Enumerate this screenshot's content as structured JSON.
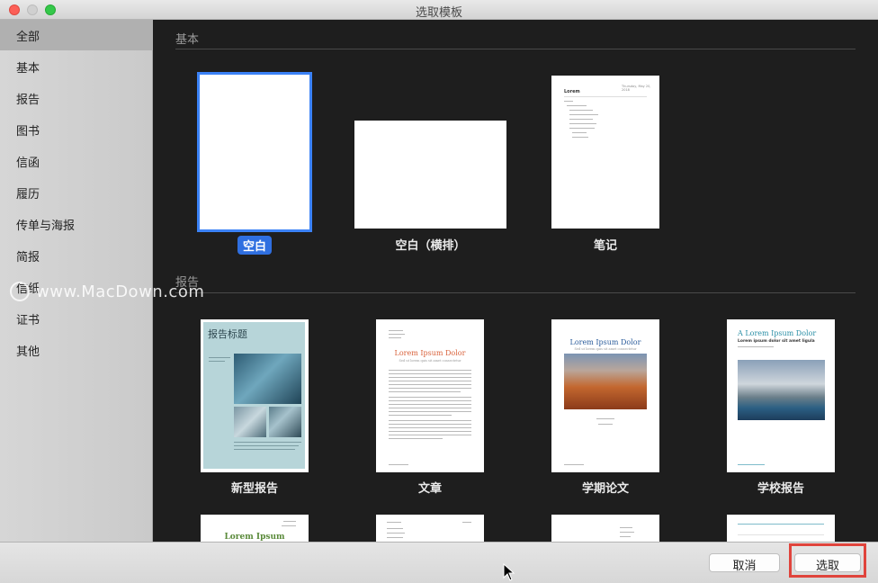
{
  "window": {
    "title": "选取模板"
  },
  "sidebar": {
    "items": [
      {
        "label": "全部",
        "selected": true
      },
      {
        "label": "基本"
      },
      {
        "label": "报告"
      },
      {
        "label": "图书"
      },
      {
        "label": "信函"
      },
      {
        "label": "履历"
      },
      {
        "label": "传单与海报"
      },
      {
        "label": "简报"
      },
      {
        "label": "信纸"
      },
      {
        "label": "证书"
      },
      {
        "label": "其他"
      }
    ]
  },
  "sections": {
    "basic": {
      "label": "基本",
      "templates": [
        {
          "label": "空白",
          "selected": true
        },
        {
          "label": "空白（横排）"
        },
        {
          "label": "笔记",
          "thumb_title": "Lorem",
          "thumb_date": "Thursday, May 20, 2018"
        }
      ]
    },
    "reports": {
      "label": "报告",
      "templates": [
        {
          "label": "新型报告",
          "thumb_title": "报告标题"
        },
        {
          "label": "文章",
          "thumb_title": "Lorem Ipsum Dolor",
          "thumb_subtitle": "Sed ut lorem quis sit amet consectetur"
        },
        {
          "label": "学期论文",
          "thumb_title": "Lorem Ipsum Dolor",
          "thumb_subtitle": "Sed ut lorem quis sit amet consectetur"
        },
        {
          "label": "学校报告",
          "thumb_title": "A Lorem Ipsum Dolor",
          "thumb_subtitle": "Lorem ipsum dolor sit amet ligula"
        }
      ]
    },
    "partial_row": [
      {
        "thumb_title": "Lorem Ipsum"
      },
      {},
      {},
      {}
    ]
  },
  "watermark": {
    "text": "www.MacDown.com"
  },
  "footer": {
    "cancel_label": "取消",
    "choose_label": "选取"
  }
}
